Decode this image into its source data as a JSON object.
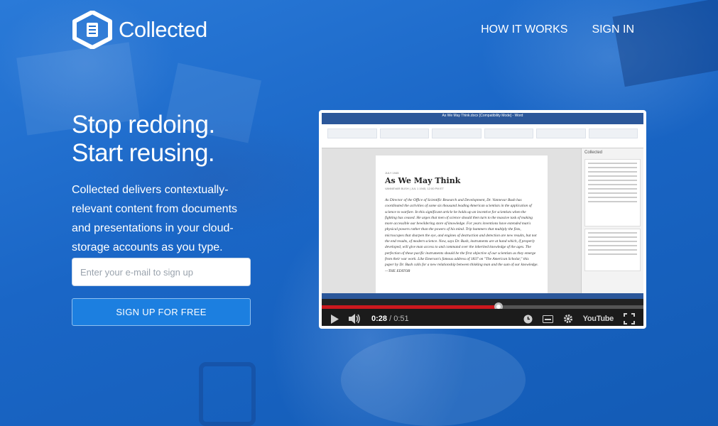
{
  "brand": {
    "name": "Collected"
  },
  "nav": {
    "how_it_works": "HOW IT WORKS",
    "sign_in": "SIGN IN"
  },
  "hero": {
    "headline_line1": "Stop redoing.",
    "headline_line2": "Start reusing.",
    "description": "Collected delivers contextually-relevant content from documents and presentations in your cloud-storage accounts as you type."
  },
  "signup": {
    "email_placeholder": "Enter your e-mail to sign up",
    "button_label": "SIGN UP FOR FREE"
  },
  "video": {
    "word_window_title": "As We May Think.docx [Compatibility Mode] - Word",
    "side_panel_title": "Collected",
    "document": {
      "meta": "JULY 1945",
      "title": "As We May Think",
      "byline": "VANNEVAR BUSH | JUL 1 1945, 12:00 PM ET",
      "body": "As Director of the Office of Scientific Research and Development, Dr. Vannevar Bush has coordinated the activities of some six thousand leading American scientists in the application of science to warfare. In this significant article he holds up an incentive for scientists when the fighting has ceased. He urges that men of science should then turn to the massive task of making more accessible our bewildering store of knowledge. For years inventions have extended man's physical powers rather than the powers of his mind. Trip hammers that multiply the fists, microscopes that sharpen the eye, and engines of destruction and detection are new results, but not the end results, of modern science. Now, says Dr. Bush, instruments are at hand which, if properly developed, will give man access to and command over the inherited knowledge of the ages. The perfection of these pacific instruments should be the first objective of our scientists as they emerge from their war work. Like Emerson's famous address of 1837 on \"The American Scholar,\" this paper by Dr. Bush calls for a new relationship between thinking man and the sum of our knowledge. —THE EDITOR"
    },
    "player": {
      "current_time": "0:28",
      "separator": "/",
      "duration": "0:51",
      "progress": 0.549,
      "youtube_label": "YouTube"
    }
  },
  "colors": {
    "accent": "#1c7fe0",
    "background": "#1f6fd0",
    "progress": "#cc181e"
  }
}
